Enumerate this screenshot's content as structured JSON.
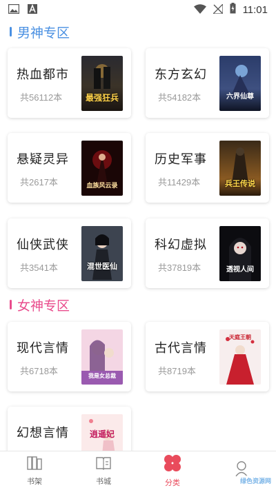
{
  "status_bar": {
    "time": "11:01"
  },
  "sections": [
    {
      "title": "男神专区",
      "accent": "#4a90e2"
    },
    {
      "title": "女神专区",
      "accent": "#e94b8c"
    }
  ],
  "male_categories": [
    {
      "name": "热血都市",
      "count": "共56112本",
      "cover_text": "最强狂兵"
    },
    {
      "name": "东方玄幻",
      "count": "共54182本",
      "cover_text": "六界仙尊"
    },
    {
      "name": "悬疑灵异",
      "count": "共2617本",
      "cover_text": "血族风云录"
    },
    {
      "name": "历史军事",
      "count": "共11429本",
      "cover_text": "兵王传说"
    },
    {
      "name": "仙侠武侠",
      "count": "共3541本",
      "cover_text": "混世医仙"
    },
    {
      "name": "科幻虚拟",
      "count": "共37819本",
      "cover_text": "透视人间"
    }
  ],
  "female_categories": [
    {
      "name": "现代言情",
      "count": "共6718本",
      "cover_text": "我是女总裁"
    },
    {
      "name": "古代言情",
      "count": "共8719本",
      "cover_text": "天庭王朝"
    },
    {
      "name": "幻想言情",
      "count": "",
      "cover_text": "逍遥妃"
    }
  ],
  "bottom_nav": [
    {
      "label": "书架",
      "icon": "bookshelf-icon"
    },
    {
      "label": "书城",
      "icon": "bookstore-icon"
    },
    {
      "label": "分类",
      "icon": "category-icon",
      "active": true
    },
    {
      "label": "",
      "icon": "profile-icon"
    }
  ],
  "watermark": "绿色资源网"
}
